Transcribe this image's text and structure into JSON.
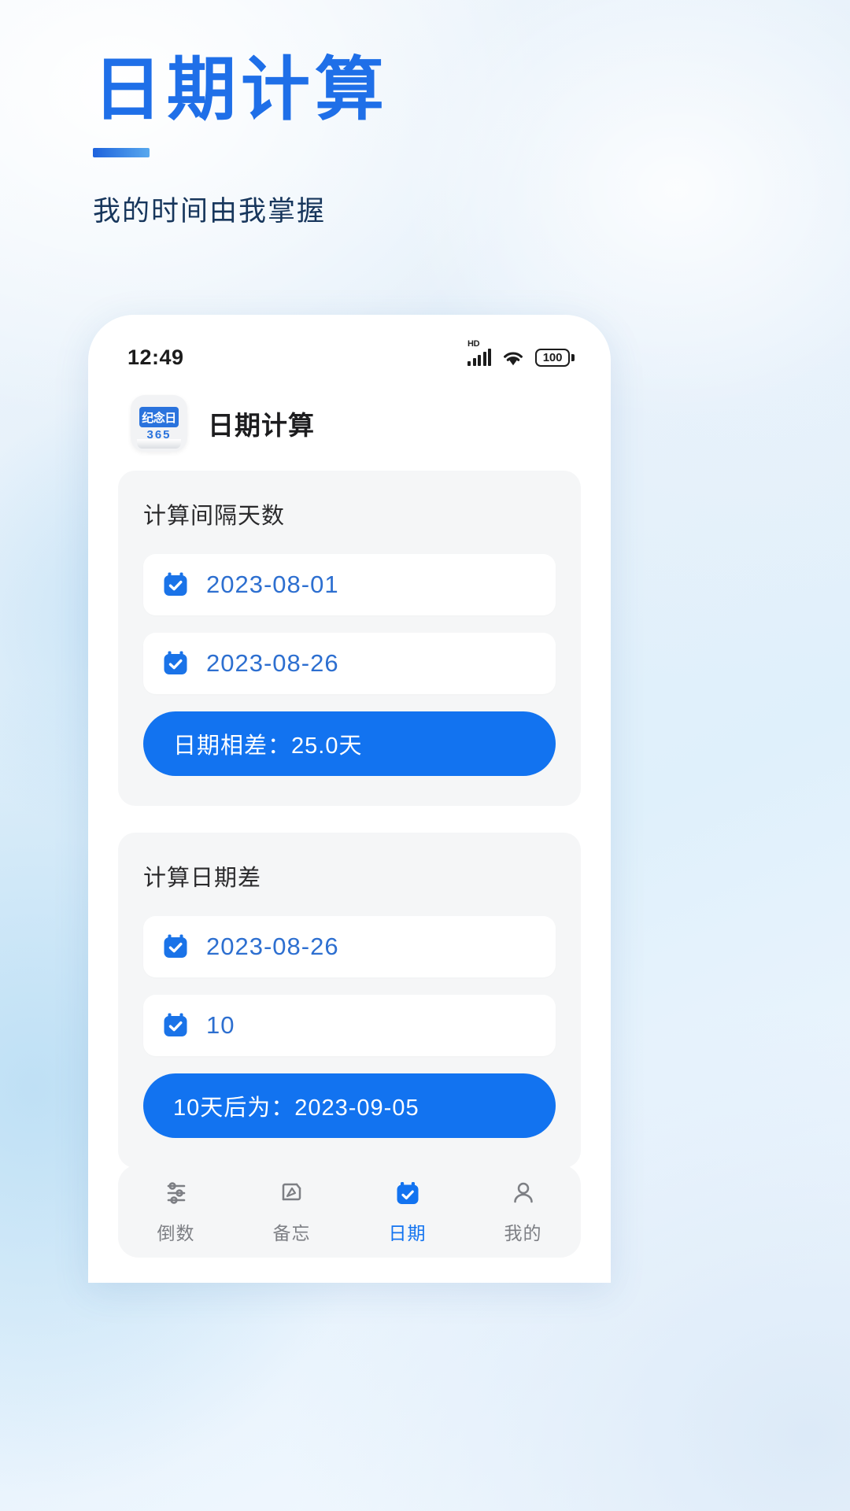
{
  "hero": {
    "title": "日期计算",
    "subtitle": "我的时间由我掌握",
    "accent_color": "#1f6fe8"
  },
  "phone": {
    "statusbar": {
      "time": "12:49",
      "network_tag": "HD",
      "battery_level": "100",
      "icons": [
        "hd-signal-icon",
        "wifi-icon",
        "battery-icon"
      ]
    },
    "app_header": {
      "app_icon_banner": "纪念日",
      "app_icon_number": "365",
      "title": "日期计算"
    },
    "cards": [
      {
        "title": "计算间隔天数",
        "fields": [
          {
            "icon": "calendar-check-icon",
            "value": "2023-08-01"
          },
          {
            "icon": "calendar-check-icon",
            "value": "2023-08-26"
          }
        ],
        "result": "日期相差：25.0天"
      },
      {
        "title": "计算日期差",
        "fields": [
          {
            "icon": "calendar-check-icon",
            "value": "2023-08-26"
          },
          {
            "icon": "calendar-check-icon",
            "value": "10"
          }
        ],
        "result": "10天后为：2023-09-05"
      }
    ],
    "tabbar": {
      "items": [
        {
          "label": "倒数",
          "icon": "countdown-icon",
          "active": false
        },
        {
          "label": "备忘",
          "icon": "memo-pen-icon",
          "active": false
        },
        {
          "label": "日期",
          "icon": "calendar-check-icon",
          "active": true
        },
        {
          "label": "我的",
          "icon": "person-icon",
          "active": false
        }
      ],
      "active_color": "#1273f0",
      "inactive_color": "#7d7f84"
    }
  }
}
